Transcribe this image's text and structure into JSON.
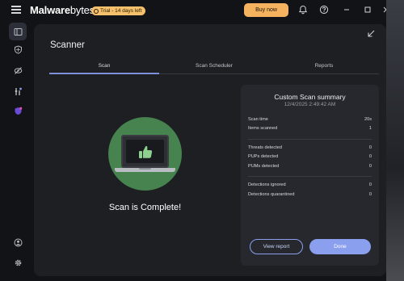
{
  "app": {
    "logo_bold": "Malware",
    "logo_rest": "bytes",
    "trial_badge": "Trial - 14 days left",
    "buy_now": "Buy now"
  },
  "sidebar": {
    "items": [
      {
        "icon": "dashboard-icon",
        "active": true
      },
      {
        "icon": "shield-scan-icon",
        "active": false
      },
      {
        "icon": "eye-slash-icon",
        "active": false
      },
      {
        "icon": "tools-icon",
        "active": false
      },
      {
        "icon": "vpn-shield-icon",
        "active": false
      }
    ],
    "bottom": [
      "account-icon",
      "settings-gear-icon"
    ]
  },
  "page": {
    "title": "Scanner",
    "tabs": [
      {
        "label": "Scan",
        "active": true
      },
      {
        "label": "Scan Scheduler",
        "active": false
      },
      {
        "label": "Reports",
        "active": false
      }
    ],
    "status_text": "Scan is Complete!"
  },
  "summary": {
    "title": "Custom Scan summary",
    "date": "12/4/2025 2:49:42 AM",
    "group1": [
      {
        "label": "Scan time",
        "value": "20s"
      },
      {
        "label": "Items scanned",
        "value": "1"
      }
    ],
    "group2": [
      {
        "label": "Threats detected",
        "value": "0"
      },
      {
        "label": "PUPs detected",
        "value": "0"
      },
      {
        "label": "PUMs detected",
        "value": "0"
      }
    ],
    "group3": [
      {
        "label": "Detections ignored",
        "value": "0"
      },
      {
        "label": "Detections quarantined",
        "value": "0"
      }
    ],
    "view_report": "View report",
    "done": "Done"
  },
  "colors": {
    "accent": "#8aa0ef",
    "buy_button": "#f6b35f",
    "trial_badge": "#f5c16c",
    "success_circle": "#46834f"
  }
}
